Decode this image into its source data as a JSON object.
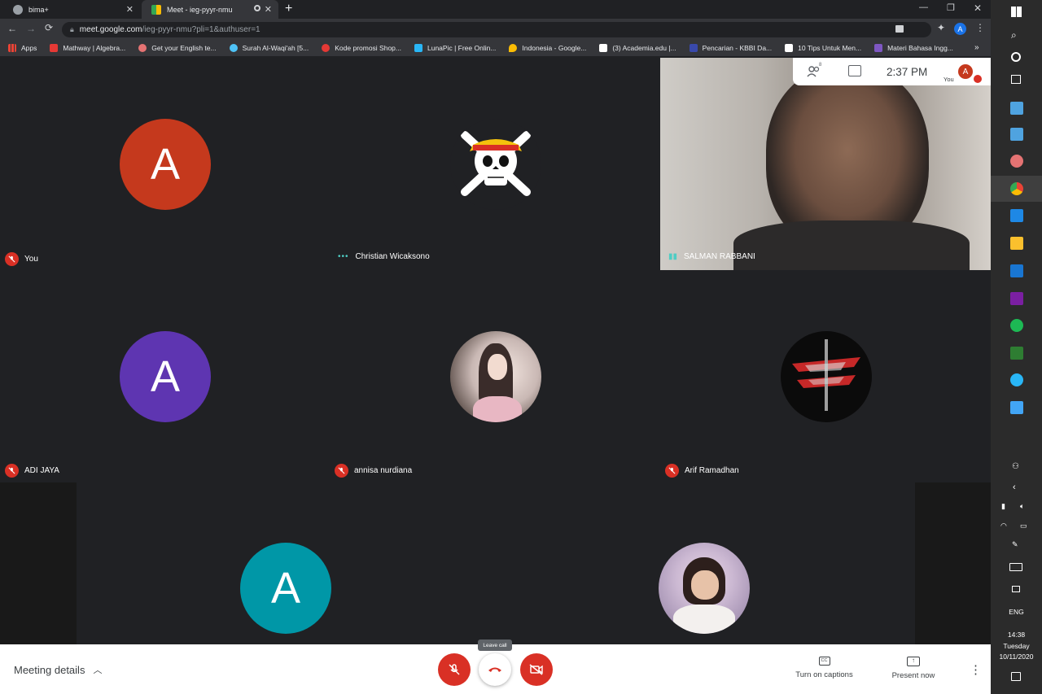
{
  "browser": {
    "tabs": [
      {
        "label": "bima+"
      },
      {
        "label": "Meet - ieg-pyyr-nmu"
      }
    ],
    "address": {
      "host": "meet.google.com",
      "path": "/ieg-pyyr-nmu?pli=1&authuser=1"
    },
    "profile_initial": "A",
    "bookmarks": [
      {
        "label": "Apps",
        "color": "#ea4335"
      },
      {
        "label": "Mathway | Algebra...",
        "color": "#e53935"
      },
      {
        "label": "Get your English te...",
        "color": "#e57373"
      },
      {
        "label": "Surah Al-Waqi'ah [5...",
        "color": "#4fc3f7"
      },
      {
        "label": "Kode promosi Shop...",
        "color": "#e53935"
      },
      {
        "label": "LunaPic | Free Onlin...",
        "color": "#29b6f6"
      },
      {
        "label": "Indonesia - Google...",
        "color": "#fbbc04"
      },
      {
        "label": "(3) Academia.edu |...",
        "color": "#ffffff"
      },
      {
        "label": "Pencarian - KBBI Da...",
        "color": "#3949ab"
      },
      {
        "label": "10 Tips Untuk Men...",
        "color": "#ffffff"
      },
      {
        "label": "Materi Bahasa Ingg...",
        "color": "#7e57c2"
      }
    ],
    "overflow": "»"
  },
  "meet": {
    "infobar": {
      "people_count": "8",
      "time": "2:37 PM",
      "you_label": "You",
      "avatar_initial": "A"
    },
    "participants": [
      {
        "name": "You",
        "initial": "A",
        "color": "#c5391d",
        "muted": true
      },
      {
        "name": "Christian Wicaksono",
        "muted": false,
        "avatar": "straw-hat-jolly-roger"
      },
      {
        "name": "SALMAN RABBANI",
        "muted": false,
        "video": true
      },
      {
        "name": "ADI JAYA",
        "initial": "A",
        "color": "#5e35b1",
        "muted": true
      },
      {
        "name": "annisa nurdiana",
        "muted": true,
        "avatar": "anime-girl-photo"
      },
      {
        "name": "Arif Ramadhan",
        "muted": true,
        "avatar": "dark-logo"
      },
      {
        "name": "",
        "initial": "A",
        "color": "#0097a7"
      },
      {
        "name": "",
        "avatar": "girl-photo"
      }
    ],
    "bottombar": {
      "meeting_details": "Meeting details",
      "tooltip": "Leave call",
      "captions": "Turn on captions",
      "present": "Present now"
    }
  },
  "taskbar": {
    "lang": "ENG",
    "time": "14:38",
    "day": "Tuesday",
    "date": "10/11/2020"
  },
  "colors": {
    "accent_red": "#d93025",
    "meet_bg": "#202124",
    "taskbar_bg": "#2b2b2b"
  }
}
